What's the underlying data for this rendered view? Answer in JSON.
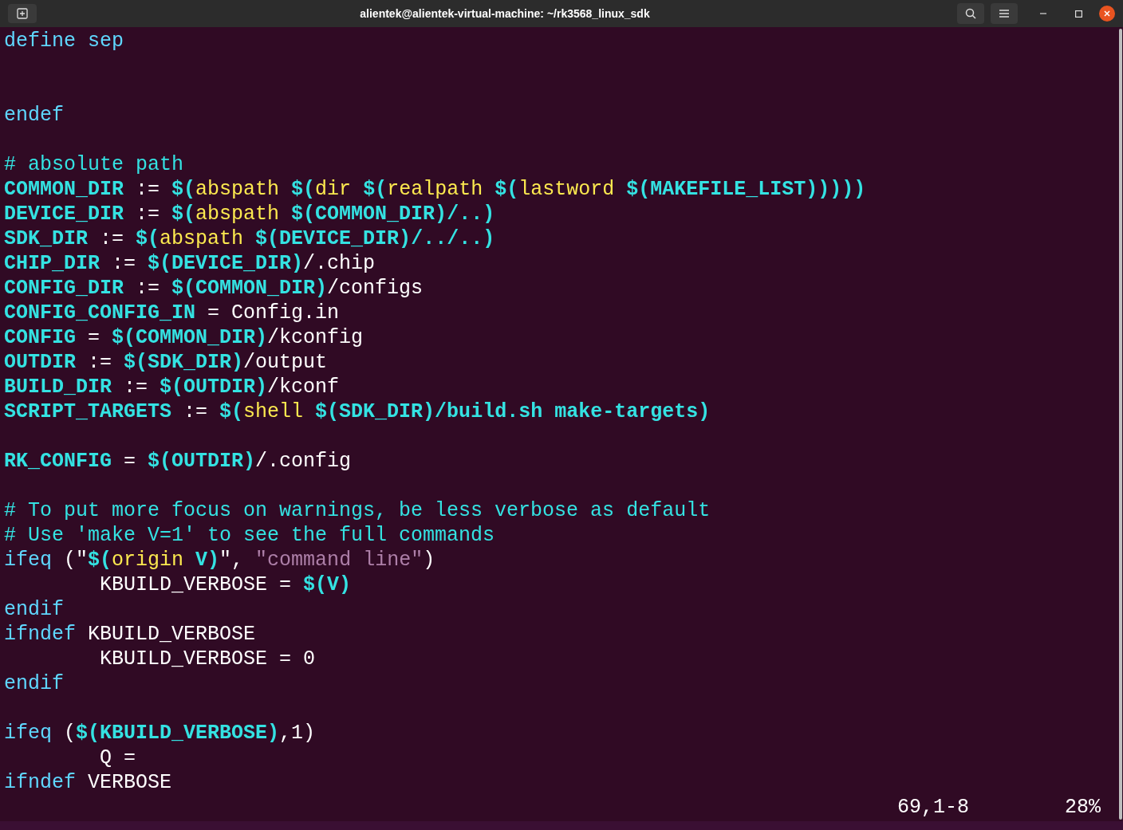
{
  "window": {
    "title": "alientek@alientek-virtual-machine: ~/rk3568_linux_sdk"
  },
  "editor": {
    "lines": [
      {
        "kind": "code",
        "segments": [
          {
            "kind": "keyword",
            "text": "define sep"
          }
        ]
      },
      {
        "kind": "blank"
      },
      {
        "kind": "blank"
      },
      {
        "kind": "code",
        "segments": [
          {
            "kind": "keyword",
            "text": "endef"
          }
        ]
      },
      {
        "kind": "blank"
      },
      {
        "kind": "code",
        "segments": [
          {
            "kind": "comment",
            "text": "# absolute path"
          }
        ]
      },
      {
        "kind": "code",
        "segments": [
          {
            "kind": "variable",
            "text": "COMMON_DIR"
          },
          {
            "kind": "plain",
            "text": " := "
          },
          {
            "kind": "variable",
            "text": "$("
          },
          {
            "kind": "function",
            "text": "abspath "
          },
          {
            "kind": "variable",
            "text": "$("
          },
          {
            "kind": "function",
            "text": "dir "
          },
          {
            "kind": "variable",
            "text": "$("
          },
          {
            "kind": "function",
            "text": "realpath "
          },
          {
            "kind": "variable",
            "text": "$("
          },
          {
            "kind": "function",
            "text": "lastword "
          },
          {
            "kind": "variable",
            "text": "$(MAKEFILE_LIST)))))"
          }
        ]
      },
      {
        "kind": "code",
        "segments": [
          {
            "kind": "variable",
            "text": "DEVICE_DIR"
          },
          {
            "kind": "plain",
            "text": " := "
          },
          {
            "kind": "variable",
            "text": "$("
          },
          {
            "kind": "function",
            "text": "abspath "
          },
          {
            "kind": "variable",
            "text": "$(COMMON_DIR)/..)"
          }
        ]
      },
      {
        "kind": "code",
        "segments": [
          {
            "kind": "variable",
            "text": "SDK_DIR"
          },
          {
            "kind": "plain",
            "text": " := "
          },
          {
            "kind": "variable",
            "text": "$("
          },
          {
            "kind": "function",
            "text": "abspath "
          },
          {
            "kind": "variable",
            "text": "$(DEVICE_DIR)/../..)"
          }
        ]
      },
      {
        "kind": "code",
        "segments": [
          {
            "kind": "variable",
            "text": "CHIP_DIR"
          },
          {
            "kind": "plain",
            "text": " := "
          },
          {
            "kind": "variable",
            "text": "$(DEVICE_DIR)"
          },
          {
            "kind": "plain",
            "text": "/.chip"
          }
        ]
      },
      {
        "kind": "code",
        "segments": [
          {
            "kind": "variable",
            "text": "CONFIG_DIR"
          },
          {
            "kind": "plain",
            "text": " := "
          },
          {
            "kind": "variable",
            "text": "$(COMMON_DIR)"
          },
          {
            "kind": "plain",
            "text": "/configs"
          }
        ]
      },
      {
        "kind": "code",
        "segments": [
          {
            "kind": "variable",
            "text": "CONFIG_CONFIG_IN"
          },
          {
            "kind": "plain",
            "text": " = Config.in"
          }
        ]
      },
      {
        "kind": "code",
        "segments": [
          {
            "kind": "variable",
            "text": "CONFIG"
          },
          {
            "kind": "plain",
            "text": " = "
          },
          {
            "kind": "variable",
            "text": "$(COMMON_DIR)"
          },
          {
            "kind": "plain",
            "text": "/kconfig"
          }
        ]
      },
      {
        "kind": "code",
        "segments": [
          {
            "kind": "variable",
            "text": "OUTDIR"
          },
          {
            "kind": "plain",
            "text": " := "
          },
          {
            "kind": "variable",
            "text": "$(SDK_DIR)"
          },
          {
            "kind": "plain",
            "text": "/output"
          }
        ]
      },
      {
        "kind": "code",
        "segments": [
          {
            "kind": "variable",
            "text": "BUILD_DIR"
          },
          {
            "kind": "plain",
            "text": " := "
          },
          {
            "kind": "variable",
            "text": "$(OUTDIR)"
          },
          {
            "kind": "plain",
            "text": "/kconf"
          }
        ]
      },
      {
        "kind": "code",
        "segments": [
          {
            "kind": "variable",
            "text": "SCRIPT_TARGETS"
          },
          {
            "kind": "plain",
            "text": " := "
          },
          {
            "kind": "variable",
            "text": "$("
          },
          {
            "kind": "function",
            "text": "shell "
          },
          {
            "kind": "variable",
            "text": "$(SDK_DIR)/build.sh make-targets)"
          }
        ]
      },
      {
        "kind": "blank"
      },
      {
        "kind": "code",
        "segments": [
          {
            "kind": "variable",
            "text": "RK_CONFIG"
          },
          {
            "kind": "plain",
            "text": " = "
          },
          {
            "kind": "variable",
            "text": "$(OUTDIR)"
          },
          {
            "kind": "plain",
            "text": "/.config"
          }
        ]
      },
      {
        "kind": "blank"
      },
      {
        "kind": "code",
        "segments": [
          {
            "kind": "comment",
            "text": "# To put more focus on warnings, be less verbose as default"
          }
        ]
      },
      {
        "kind": "code",
        "segments": [
          {
            "kind": "comment",
            "text": "# Use 'make V=1' to see the full commands"
          }
        ]
      },
      {
        "kind": "code",
        "segments": [
          {
            "kind": "keyword",
            "text": "ifeq"
          },
          {
            "kind": "plain",
            "text": " (\""
          },
          {
            "kind": "variable",
            "text": "$("
          },
          {
            "kind": "function",
            "text": "origin "
          },
          {
            "kind": "variable",
            "text": "V)"
          },
          {
            "kind": "plain",
            "text": "\", "
          },
          {
            "kind": "string",
            "text": "\"command line\""
          },
          {
            "kind": "plain",
            "text": ")"
          }
        ]
      },
      {
        "kind": "code",
        "segments": [
          {
            "kind": "plain",
            "text": "        KBUILD_VERBOSE = "
          },
          {
            "kind": "variable",
            "text": "$(V)"
          }
        ]
      },
      {
        "kind": "code",
        "segments": [
          {
            "kind": "keyword",
            "text": "endif"
          }
        ]
      },
      {
        "kind": "code",
        "segments": [
          {
            "kind": "keyword",
            "text": "ifndef"
          },
          {
            "kind": "plain",
            "text": " KBUILD_VERBOSE"
          }
        ]
      },
      {
        "kind": "code",
        "segments": [
          {
            "kind": "plain",
            "text": "        KBUILD_VERBOSE = 0"
          }
        ]
      },
      {
        "kind": "code",
        "segments": [
          {
            "kind": "keyword",
            "text": "endif"
          }
        ]
      },
      {
        "kind": "blank"
      },
      {
        "kind": "code",
        "segments": [
          {
            "kind": "keyword",
            "text": "ifeq"
          },
          {
            "kind": "plain",
            "text": " ("
          },
          {
            "kind": "variable",
            "text": "$(KBUILD_VERBOSE)"
          },
          {
            "kind": "plain",
            "text": ",1)"
          }
        ]
      },
      {
        "kind": "code",
        "segments": [
          {
            "kind": "plain",
            "text": "        Q ="
          }
        ]
      },
      {
        "kind": "code",
        "segments": [
          {
            "kind": "keyword",
            "text": "ifndef"
          },
          {
            "kind": "plain",
            "text": " VERBOSE"
          }
        ]
      }
    ]
  },
  "status_bar": {
    "position": "69,1-8",
    "percent": "28%"
  }
}
